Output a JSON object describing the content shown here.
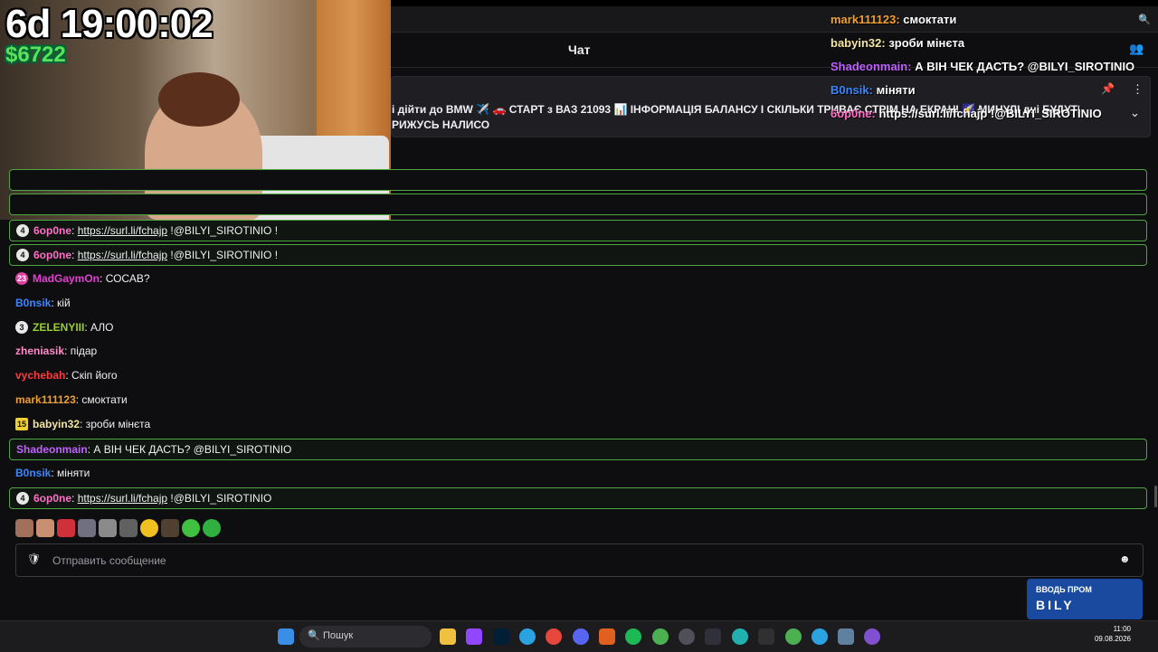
{
  "stream": {
    "timer": "6d 19:00:02",
    "money": "$6722"
  },
  "chat": {
    "title": "Чат",
    "pinned": {
      "line1": "і дійти до BMW ✈️ 🚗 СТАРТ з ВАЗ 21093 📊 ІНФОРМАЦІЯ БАЛАНСУ І СКІЛЬКИ ТРИВАЄ СТРІМ НА ЕКРАНІ 🌠 МИНУЛІ дні БУДУТЬ",
      "line2": "РИЖУСЬ НАЛИСО"
    },
    "messages": [
      {
        "badge": "4",
        "user": "6op0ne",
        "color": "#ff6ec7",
        "sep": ": ",
        "link": "https://surl.li/fchajp",
        "text": " !@BILYI_SIROTINIO !"
      },
      {
        "badge": "4",
        "user": "6op0ne",
        "color": "#ff6ec7",
        "sep": ": ",
        "link": "https://surl.li/fchajp",
        "text": " !@BILYI_SIROTINIO !"
      },
      {
        "badge": "23",
        "user": "MadGaymOn",
        "color": "#e040d0",
        "sep": ": ",
        "link": "",
        "text": "СОСАВ?"
      },
      {
        "badge": "",
        "user": "B0nsik",
        "color": "#3a86ff",
        "sep": ": ",
        "link": "",
        "text": "кій"
      },
      {
        "badge": "3",
        "user": "ZELENYIII",
        "color": "#9acd32",
        "sep": ": ",
        "link": "",
        "text": "АЛО"
      },
      {
        "badge": "",
        "user": "zheniasik",
        "color": "#ff8ac8",
        "sep": ": ",
        "link": "",
        "text": "підар"
      },
      {
        "badge": "",
        "user": "vychebah",
        "color": "#ff3b3b",
        "sep": ": ",
        "link": "",
        "text": "Скіп його"
      },
      {
        "badge": "",
        "user": "mark111123",
        "color": "#f0a030",
        "sep": ": ",
        "link": "",
        "text": "смоктати"
      },
      {
        "badge": "15",
        "user": "babyin32",
        "color": "#f5e6a0",
        "sep": ": ",
        "link": "",
        "text": "зроби мінєта"
      },
      {
        "badge": "",
        "user": "Shadeonmain",
        "color": "#c060ff",
        "sep": ": ",
        "link": "",
        "text": "А ВІН ЧЕК ДАСТЬ? @BILYI_SIROTINIO"
      },
      {
        "badge": "",
        "user": "B0nsik",
        "color": "#3a86ff",
        "sep": ": ",
        "link": "",
        "text": "міняти"
      },
      {
        "badge": "4",
        "user": "6op0ne",
        "color": "#ff6ec7",
        "sep": ": ",
        "link": "https://surl.li/fchajp",
        "text": " !@BILYI_SIROTINIO"
      }
    ],
    "overlay": [
      {
        "user": "mark111123",
        "color": "#f0a030",
        "text": "смоктати"
      },
      {
        "user": "babyin32",
        "color": "#f5e6a0",
        "text": "зроби мінєта"
      },
      {
        "user": "Shadeonmain",
        "color": "#c060ff",
        "text": "А ВІН ЧЕК ДАСТЬ? @BILYI_SIROTINIO"
      },
      {
        "user": "B0nsik",
        "color": "#3a86ff",
        "text": "міняти"
      },
      {
        "user": "6op0ne",
        "color": "#ff6ec7",
        "text": "https://surl.li/fchajp !@BILYI_SIROTINIO"
      }
    ],
    "input_placeholder": "Отправить сообщение"
  },
  "promo": {
    "line1": "ВВОДЬ ПРОМ",
    "line2": "BILY"
  },
  "taskbar": {
    "search_label": "Пошук",
    "time": "11:00",
    "date": "09.08.2026"
  },
  "colors": {
    "highlight_border": "#4ea542",
    "bg": "#0e0e10"
  }
}
